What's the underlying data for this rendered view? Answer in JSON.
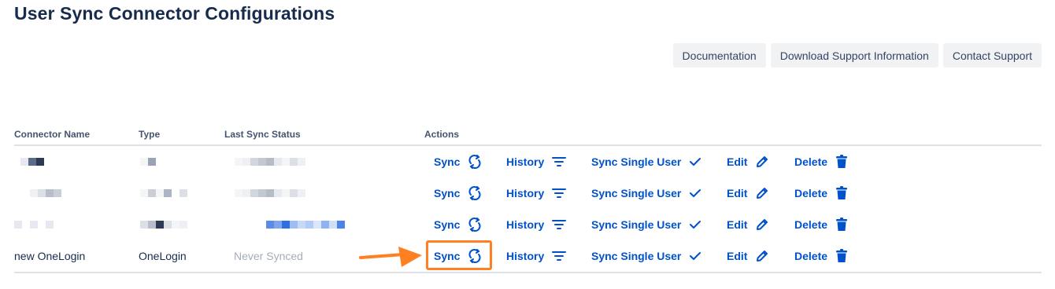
{
  "page": {
    "title": "User Sync Connector Configurations"
  },
  "toolbar": {
    "documentation_label": "Documentation",
    "download_support_label": "Download Support Information",
    "contact_support_label": "Contact Support"
  },
  "table": {
    "columns": {
      "name": "Connector Name",
      "type": "Type",
      "status": "Last Sync Status",
      "actions": "Actions"
    },
    "action_labels": {
      "sync": "Sync",
      "history": "History",
      "sync_single_user": "Sync Single User",
      "edit": "Edit",
      "delete": "Delete"
    },
    "rows": [
      {
        "name": "",
        "type": "",
        "status": "",
        "redacted": true
      },
      {
        "name": "",
        "type": "",
        "status": "",
        "redacted": true
      },
      {
        "name": "",
        "type": "",
        "status": "",
        "redacted": true
      },
      {
        "name": "new OneLogin",
        "type": "OneLogin",
        "status": "Never Synced",
        "redacted": false
      }
    ]
  },
  "colors": {
    "link": "#0052cc",
    "highlight": "#ff8022",
    "text": "#172b4d",
    "muted": "#a5adba"
  },
  "icons": {
    "sync": "refresh-icon",
    "history": "filter-lines-icon",
    "sync_single_user": "check-icon",
    "edit": "pencil-icon",
    "delete": "trash-icon"
  }
}
